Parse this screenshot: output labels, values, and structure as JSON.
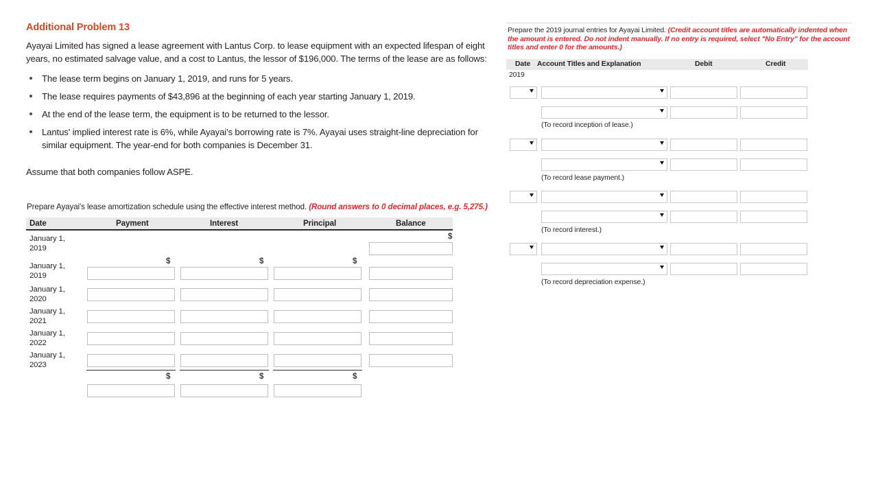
{
  "problem": {
    "title": "Additional Problem 13",
    "intro": "Ayayai Limited has signed a lease agreement with Lantus Corp. to lease equipment with an expected lifespan of eight years, no estimated salvage value, and a cost to Lantus, the lessor of $196,000. The terms of the lease are as follows:",
    "terms": [
      "The lease term begins on January 1, 2019, and runs for 5 years.",
      "The lease requires payments of $43,896 at the beginning of each year starting January 1, 2019.",
      "At the end of the lease term, the equipment is to be returned to the lessor.",
      "Lantus' implied interest rate is 6%, while Ayayai's borrowing rate is 7%. Ayayai uses straight-line depreciation for similar equipment. The year-end for both companies is December 31."
    ],
    "assumption": "Assume that both companies follow ASPE."
  },
  "schedule": {
    "instruction_plain": "Prepare Ayayai's lease amortization schedule using the effective interest method.",
    "instruction_red": "(Round answers to 0 decimal places, e.g. 5,275.)",
    "columns": [
      "Date",
      "Payment",
      "Interest",
      "Principal",
      "Balance"
    ],
    "currency_symbol": "$",
    "rows": [
      {
        "date_line1": "January 1,",
        "date_line2": "2019"
      },
      {
        "date_line1": "January 1,",
        "date_line2": "2019"
      },
      {
        "date_line1": "January 1,",
        "date_line2": "2020"
      },
      {
        "date_line1": "January 1,",
        "date_line2": "2021"
      },
      {
        "date_line1": "January 1,",
        "date_line2": "2022"
      },
      {
        "date_line1": "January 1,",
        "date_line2": "2023"
      }
    ],
    "input_values": {
      "r0_balance": "",
      "r1_payment": "",
      "r1_interest": "",
      "r1_principal": "",
      "r1_balance": "",
      "r2_payment": "",
      "r2_interest": "",
      "r2_principal": "",
      "r2_balance": "",
      "r3_payment": "",
      "r3_interest": "",
      "r3_principal": "",
      "r3_balance": "",
      "r4_payment": "",
      "r4_interest": "",
      "r4_principal": "",
      "r4_balance": "",
      "r5_payment": "",
      "r5_interest": "",
      "r5_principal": "",
      "r5_balance": "",
      "total_payment": "",
      "total_interest": "",
      "total_principal": ""
    }
  },
  "journal": {
    "instruction_plain": "Prepare the 2019 journal entries for Ayayai Limited. ",
    "instruction_red": "(Credit account titles are automatically indented when the amount is entered. Do not indent manually. If no entry is required, select \"No Entry\" for the account titles and enter 0 for the amounts.)",
    "columns": [
      "Date",
      "Account Titles and Explanation",
      "Debit",
      "Credit"
    ],
    "year": "2019",
    "entries": [
      {
        "date_value": "",
        "debit_account": "",
        "credit_account": "",
        "debit_amount": "",
        "credit_amount": "",
        "debit_amount2": "",
        "credit_amount2": "",
        "memo": "(To record inception of lease.)"
      },
      {
        "date_value": "",
        "debit_account": "",
        "credit_account": "",
        "debit_amount": "",
        "credit_amount": "",
        "debit_amount2": "",
        "credit_amount2": "",
        "memo": "(To record lease payment.)"
      },
      {
        "date_value": "",
        "debit_account": "",
        "credit_account": "",
        "debit_amount": "",
        "credit_amount": "",
        "debit_amount2": "",
        "credit_amount2": "",
        "memo": "(To record interest.)"
      },
      {
        "date_value": "",
        "debit_account": "",
        "credit_account": "",
        "debit_amount": "",
        "credit_amount": "",
        "debit_amount2": "",
        "credit_amount2": "",
        "memo": "(To record depreciation expense.)"
      }
    ],
    "dropdown_icon": "chevron-down-icon"
  },
  "colors": {
    "title": "#d2492a",
    "red_note": "#e8262d",
    "header_band": "#e9e9e9",
    "text": "#231f20",
    "input_border": "#bdbdbd"
  }
}
